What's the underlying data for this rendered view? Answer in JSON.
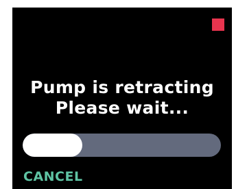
{
  "status": {
    "icon": "alert-square-icon",
    "color": "#e8344e"
  },
  "message": {
    "line1": "Pump is retracting",
    "line2": "Please wait..."
  },
  "progress": {
    "fraction": 0.3,
    "track_color": "#636a7d",
    "fill_color": "#ffffff"
  },
  "actions": {
    "cancel_label": "CANCEL",
    "cancel_color": "#5fc4a4"
  }
}
